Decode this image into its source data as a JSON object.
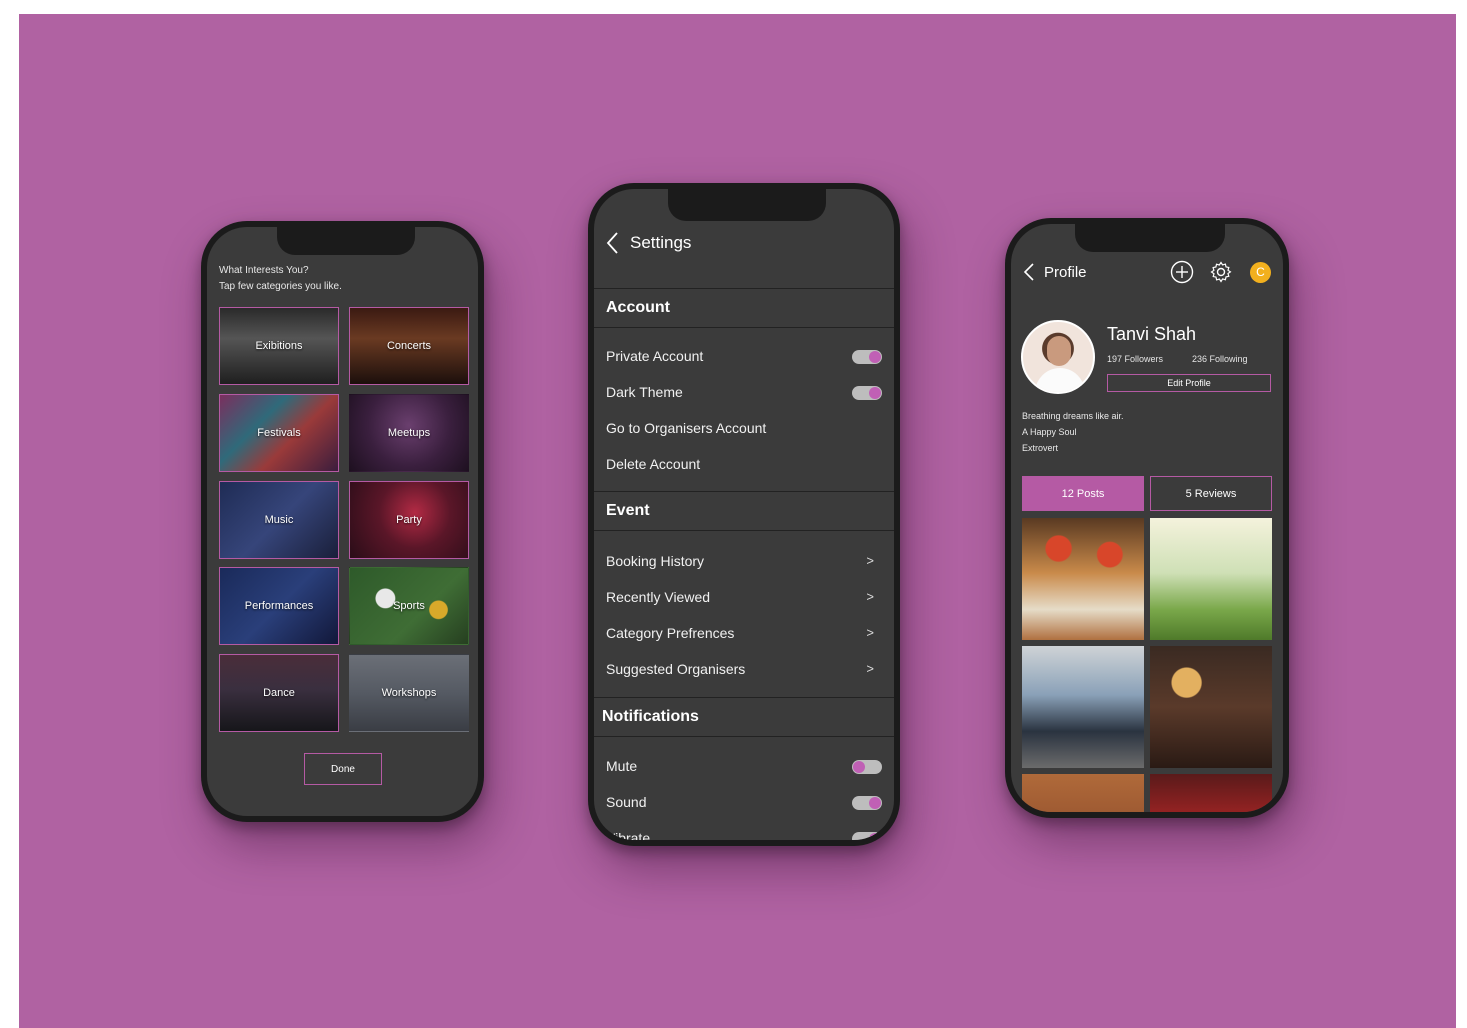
{
  "interests": {
    "heading": "What Interests You?",
    "subheading": "Tap few categories you like.",
    "categories": [
      "Exibitions",
      "Concerts",
      "Festivals",
      "Meetups",
      "Music",
      "Party",
      "Performances",
      "Sports",
      "Dance",
      "Workshops"
    ],
    "done_label": "Done"
  },
  "settings": {
    "title": "Settings",
    "account_header": "Account",
    "account_items": [
      "Private Account",
      "Dark Theme",
      "Go to Organisers Account",
      "Delete Account"
    ],
    "event_header": "Event",
    "event_items": [
      "Booking History",
      "Recently Viewed",
      "Category Prefrences",
      "Suggested Organisers"
    ],
    "chevron": ">",
    "notifications_header": "Notifications",
    "notification_items": [
      "Mute",
      "Sound",
      "Vibrate"
    ]
  },
  "profile": {
    "title": "Profile",
    "coin_label": "C",
    "name": "Tanvi Shah",
    "followers_count": "197",
    "followers_label": "Followers",
    "following_count": "236",
    "following_label": "Following",
    "edit_label": "Edit  Profile",
    "bio": [
      "Breathing dreams like air.",
      "A Happy Soul",
      "Extrovert"
    ],
    "posts_count": "12",
    "posts_label": "Posts",
    "reviews_count": "5",
    "reviews_label": "Reviews"
  },
  "colors": {
    "background": "#b062a2",
    "screen": "#3b3b3b",
    "accent": "#b55aa4",
    "coin": "#f2b01e"
  }
}
